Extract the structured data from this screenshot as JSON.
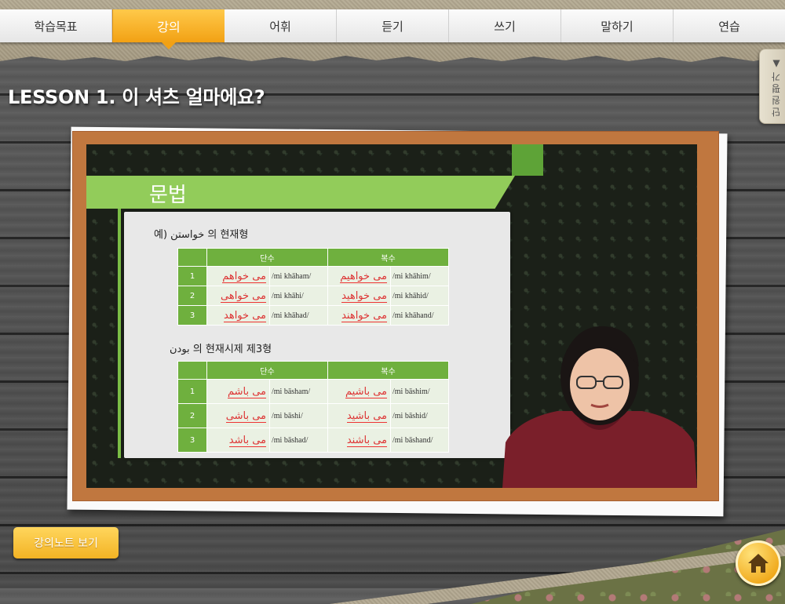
{
  "tabs": [
    {
      "label": "학습목표",
      "active": false
    },
    {
      "label": "강의",
      "active": true
    },
    {
      "label": "어휘",
      "active": false
    },
    {
      "label": "듣기",
      "active": false
    },
    {
      "label": "쓰기",
      "active": false
    },
    {
      "label": "말하기",
      "active": false
    },
    {
      "label": "연습",
      "active": false
    }
  ],
  "lesson_title": "LESSON 1. 이 셔츠 얼마에요?",
  "side_tab_label": "단원평가▲",
  "slide": {
    "heading": "문법",
    "section1_label": "예) خواستن 의 현재형",
    "section2_label": "بودن 의 현재시제 제3형",
    "table_headers": {
      "singular": "단수",
      "plural": "복수"
    },
    "table1": [
      {
        "num": "1",
        "sg_ar": "می خواهم",
        "sg_rom": "/mi khāham/",
        "pl_ar": "می خواهیم",
        "pl_rom": "/mi khāhim/"
      },
      {
        "num": "2",
        "sg_ar": "می خواهی",
        "sg_rom": "/mi khāhi/",
        "pl_ar": "می خواهید",
        "pl_rom": "/mi khāhid/"
      },
      {
        "num": "3",
        "sg_ar": "می خواهد",
        "sg_rom": "/mi khāhad/",
        "pl_ar": "می خواهند",
        "pl_rom": "/mi khāhand/"
      }
    ],
    "table2": [
      {
        "num": "1",
        "sg_ar": "می باشم",
        "sg_rom": "/mi bāsham/",
        "pl_ar": "می باشیم",
        "pl_rom": "/mi bāshim/"
      },
      {
        "num": "2",
        "sg_ar": "می باشی",
        "sg_rom": "/mi bāshi/",
        "pl_ar": "می باشید",
        "pl_rom": "/mi bāshid/"
      },
      {
        "num": "3",
        "sg_ar": "می باشد",
        "sg_rom": "/mi bāshad/",
        "pl_ar": "می باشند",
        "pl_rom": "/mi bāshand/"
      }
    ]
  },
  "notes_button": "강의노트 보기",
  "colors": {
    "accent": "#f2a114",
    "slide_green": "#6fb03e",
    "frame_wood": "#c0773f"
  }
}
